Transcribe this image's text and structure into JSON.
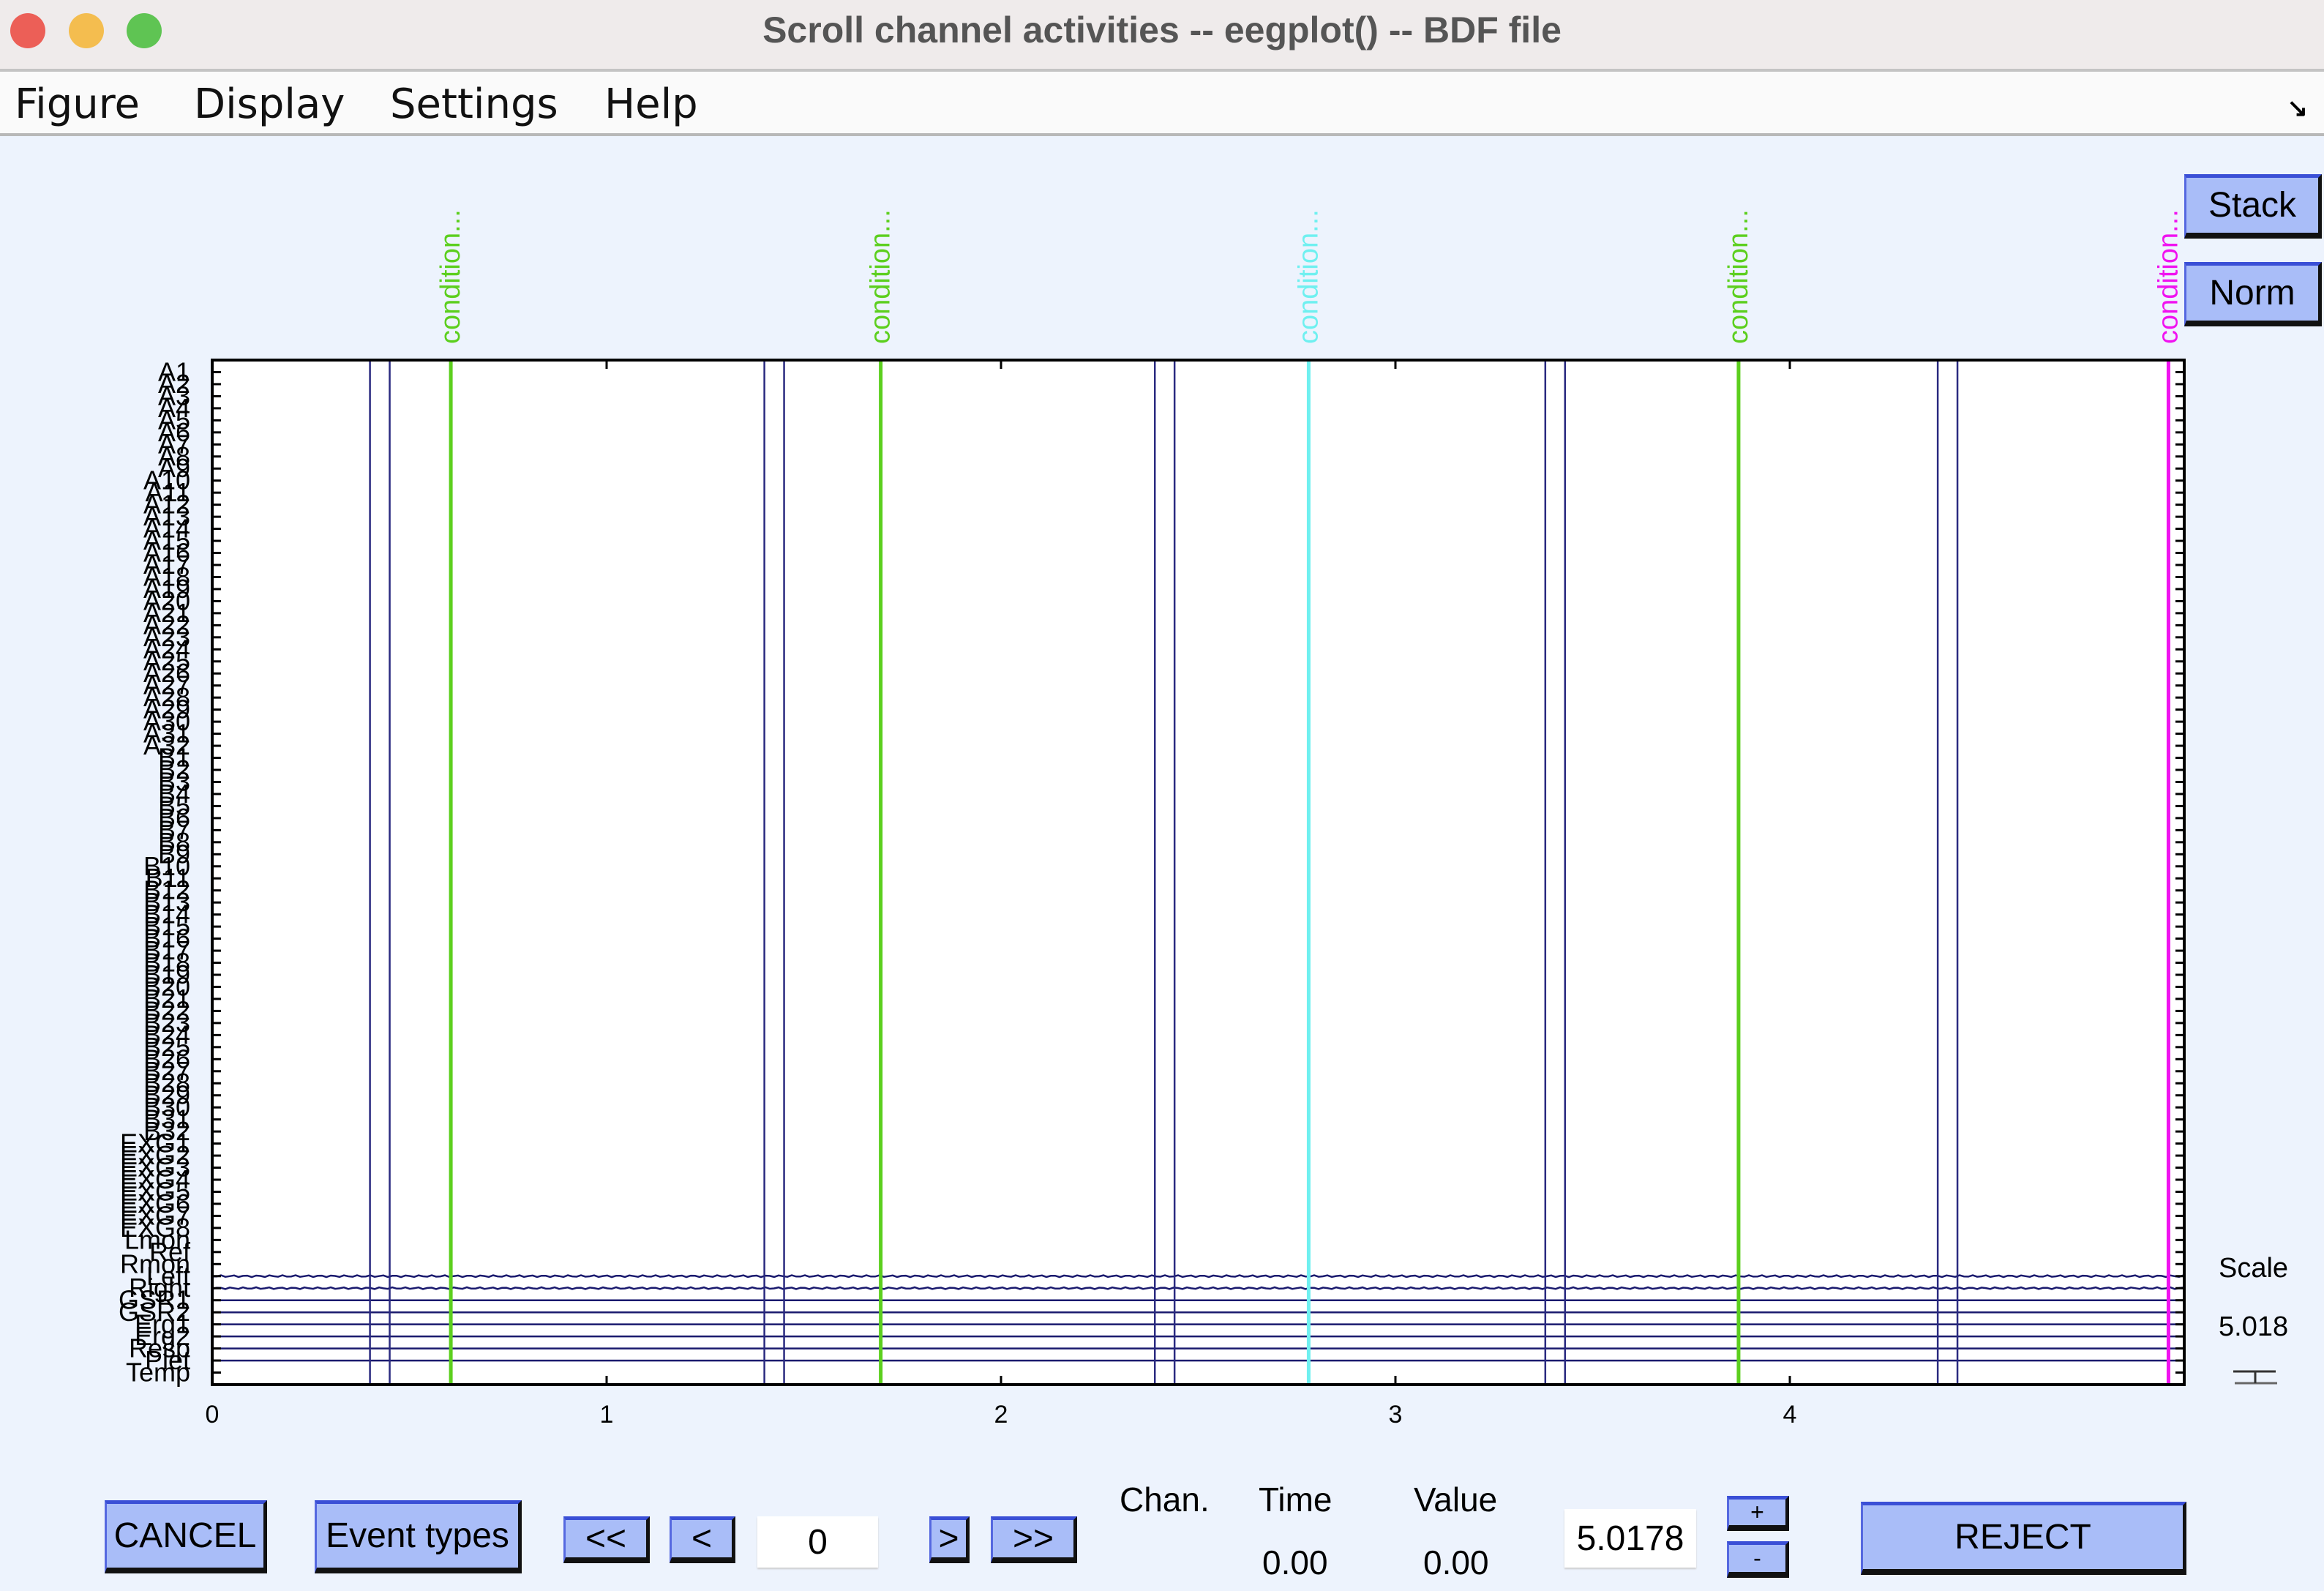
{
  "window": {
    "title": "Scroll channel activities -- eegplot() -- BDF file",
    "traffic_lights": [
      "#ec5f57",
      "#f4bd4f",
      "#5fc453"
    ]
  },
  "menu": [
    "Figure",
    "Display",
    "Settings",
    "Help"
  ],
  "side_buttons": {
    "stack": "Stack",
    "norm": "Norm"
  },
  "scale": {
    "label": "Scale",
    "value": "5.018"
  },
  "bottom": {
    "cancel": "CANCEL",
    "event_types": "Event types",
    "first": "<<",
    "prev": "<",
    "position": "0",
    "next": ">",
    "last": ">>",
    "chan_label": "Chan.",
    "time_label": "Time",
    "value_label": "Value",
    "time_value": "0.00",
    "value_value": "0.00",
    "scale_input": "5.0178",
    "plus": "+",
    "minus": "-",
    "reject": "REJECT"
  },
  "chart_data": {
    "type": "line",
    "xlim": [
      0,
      5
    ],
    "x_ticks": [
      "0",
      "1",
      "2",
      "3",
      "4"
    ],
    "channels": [
      "A1",
      "A2",
      "A3",
      "A4",
      "A5",
      "A6",
      "A7",
      "A8",
      "A9",
      "A10",
      "A11",
      "A12",
      "A13",
      "A14",
      "A15",
      "A16",
      "A17",
      "A18",
      "A19",
      "A20",
      "A21",
      "A22",
      "A23",
      "A24",
      "A25",
      "A26",
      "A27",
      "A28",
      "A29",
      "A30",
      "A31",
      "A32",
      "B1",
      "B2",
      "B3",
      "B4",
      "B5",
      "B6",
      "B7",
      "B8",
      "B9",
      "B10",
      "B11",
      "B12",
      "B13",
      "B14",
      "B15",
      "B16",
      "B17",
      "B18",
      "B19",
      "B20",
      "B21",
      "B22",
      "B23",
      "B24",
      "B25",
      "B26",
      "B27",
      "B28",
      "B29",
      "B30",
      "B31",
      "B32",
      "EXG1",
      "EXG2",
      "EXG3",
      "EXG4",
      "EXG5",
      "EXG6",
      "EXG7",
      "EXG8",
      "Lmon",
      "Ref",
      "Rmon",
      "Left",
      "Right",
      "GSR1",
      "GSR2",
      "Erg1",
      "Erg2",
      "Resp",
      "Plet",
      "Temp"
    ],
    "visible_traces": [
      "Left",
      "Right",
      "GSR1",
      "GSR2",
      "Erg1",
      "Erg2",
      "Resp",
      "Plet"
    ],
    "trace_color": "#1a1a6e",
    "boundaries": [
      0.4,
      0.45,
      1.4,
      1.45,
      2.39,
      2.44,
      3.38,
      3.43,
      4.375,
      4.425
    ],
    "boundary_color": "#2a2a80",
    "events": [
      {
        "time": 0.605,
        "label": "condition...",
        "color": "#5ccf1e"
      },
      {
        "time": 1.695,
        "label": "condition...",
        "color": "#5ccf1e"
      },
      {
        "time": 2.78,
        "label": "condition...",
        "color": "#6ff0f0"
      },
      {
        "time": 3.87,
        "label": "condition...",
        "color": "#5ccf1e"
      },
      {
        "time": 4.96,
        "label": "condition...",
        "color": "#f012f0"
      }
    ]
  }
}
